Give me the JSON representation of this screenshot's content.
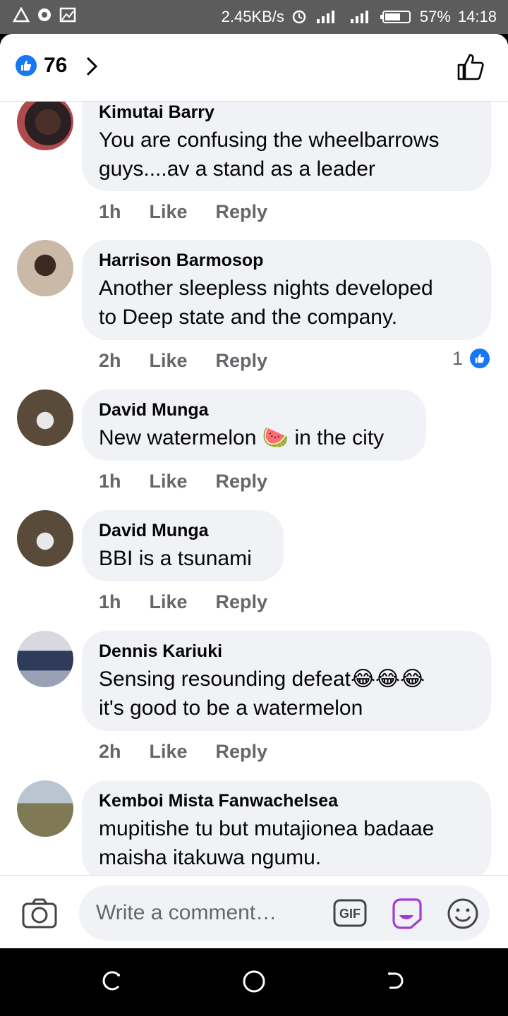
{
  "status_bar": {
    "speed": "2.45KB/s",
    "battery": "57%",
    "time": "14:18"
  },
  "header": {
    "like_count": "76"
  },
  "comments": [
    {
      "author": "Kimutai Barry",
      "lines": [
        "You are confusing the wheelbarrows",
        "guys....av a stand as a leader"
      ],
      "time": "1h",
      "like": "Like",
      "reply": "Reply",
      "reactions": ""
    },
    {
      "author": "Harrison Barmosop",
      "lines": [
        "Another sleepless nights developed",
        "to  Deep state and the company."
      ],
      "time": "2h",
      "like": "Like",
      "reply": "Reply",
      "reactions": "1"
    },
    {
      "author": "David Munga",
      "lines": [
        "New watermelon 🍉 in the city"
      ],
      "time": "1h",
      "like": "Like",
      "reply": "Reply",
      "reactions": ""
    },
    {
      "author": "David Munga",
      "lines": [
        "BBI is a tsunami"
      ],
      "time": "1h",
      "like": "Like",
      "reply": "Reply",
      "reactions": ""
    },
    {
      "author": "Dennis Kariuki",
      "lines": [
        "Sensing resounding defeat😂😂😂",
        "it's good to be a watermelon"
      ],
      "time": "2h",
      "like": "Like",
      "reply": "Reply",
      "reactions": ""
    },
    {
      "author": "Kemboi Mista Fanwachelsea",
      "lines": [
        "mupitishe tu but mutajionea badaae",
        "maisha itakuwa ngumu."
      ],
      "time": "",
      "like": "",
      "reply": "",
      "reactions": ""
    }
  ],
  "composer": {
    "placeholder": "Write a comment…",
    "gif_label": "GIF"
  },
  "colors": {
    "accent": "#1877f2",
    "bubble": "#f0f2f5",
    "meta_text": "#65676b",
    "sticker": "#a33bd6"
  }
}
